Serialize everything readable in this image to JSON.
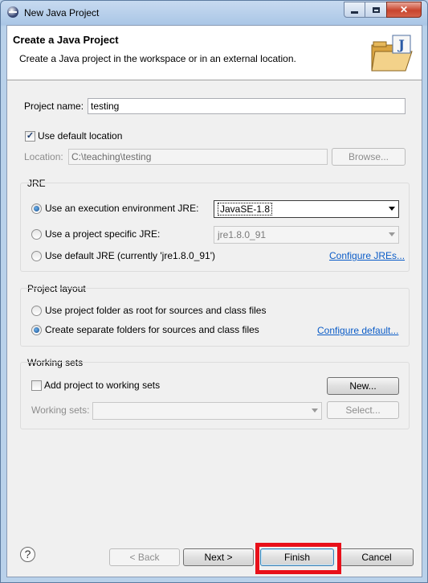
{
  "window": {
    "title": "New Java Project",
    "close_glyph": "✕"
  },
  "banner": {
    "title": "Create a Java Project",
    "description": "Create a Java project in the workspace or in an external location.",
    "icon": "java-project-folder-icon"
  },
  "project_name": {
    "label": "Project name:",
    "value": "testing"
  },
  "default_location": {
    "label": "Use default location",
    "checked": true
  },
  "location": {
    "label": "Location:",
    "value": "C:\\teaching\\testing",
    "browse_label": "Browse..."
  },
  "jre": {
    "group_title": "JRE",
    "exec_env_label": "Use an execution environment JRE:",
    "exec_env_value": "JavaSE-1.8",
    "project_specific_label": "Use a project specific JRE:",
    "project_specific_value": "jre1.8.0_91",
    "default_jre_label": "Use default JRE (currently 'jre1.8.0_91')",
    "configure_link": "Configure JREs...",
    "selected": "execution-environment"
  },
  "project_layout": {
    "group_title": "Project layout",
    "option_root": "Use project folder as root for sources and class files",
    "option_separate": "Create separate folders for sources and class files",
    "configure_link": "Configure default...",
    "selected": "separate"
  },
  "working_sets": {
    "group_title": "Working sets",
    "add_label": "Add project to working sets",
    "add_checked": false,
    "new_label": "New...",
    "sets_label": "Working sets:",
    "select_label": "Select..."
  },
  "footer": {
    "help_glyph": "?",
    "back_label": "< Back",
    "next_label": "Next >",
    "finish_label": "Finish",
    "cancel_label": "Cancel"
  },
  "colors": {
    "highlight": "#e8101a",
    "link": "#0b5cc7"
  }
}
